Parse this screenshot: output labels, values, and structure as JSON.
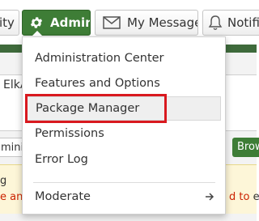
{
  "navbar": {
    "community_label": "ity",
    "admin_label": "Admin",
    "messages_label": "My Messages",
    "notifications_label": "Notifi"
  },
  "background": {
    "user_fragment": "ElkA",
    "input_fragment": "mini",
    "browse_fragment": "Brow",
    "warning_title_fragment": "g",
    "warning_left_fragment": "e an a",
    "warning_right_red": "d to",
    "warning_right_dark": " er"
  },
  "admin_menu": {
    "items": [
      {
        "label": "Administration Center"
      },
      {
        "label": "Features and Options"
      },
      {
        "label": "Package Manager"
      },
      {
        "label": "Permissions"
      },
      {
        "label": "Error Log"
      },
      {
        "label": "Moderate"
      }
    ],
    "highlighted_item": "Package Manager"
  },
  "icons": {
    "admin": "gear-icon",
    "messages": "envelope-icon",
    "notifications": "bell-icon",
    "moderate_arrow": "arrow-right-icon"
  },
  "colors": {
    "admin_green": "#3e7d36",
    "highlight_red": "#d9191f",
    "warning_red": "#cc2200"
  }
}
